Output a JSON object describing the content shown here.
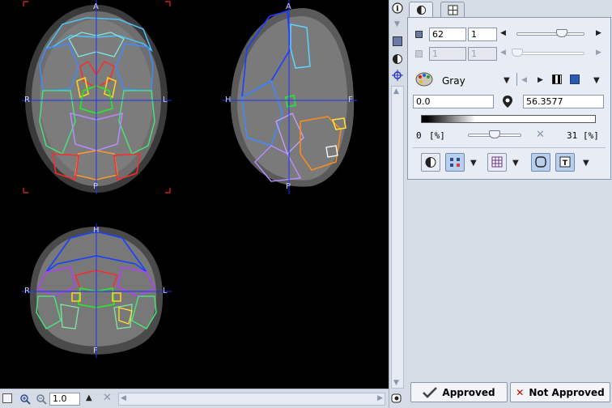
{
  "viewer": {
    "axial": {
      "top": "A",
      "bottom": "P",
      "left": "R",
      "right": "L"
    },
    "sagittal": {
      "top": "A",
      "bottom": "P",
      "left": "H",
      "right": "F"
    },
    "coronal": {
      "top": "H",
      "bottom": "F",
      "left": "R",
      "right": "L"
    }
  },
  "bottom_bar": {
    "zoom": "1.0"
  },
  "panel": {
    "tabs": [
      {
        "icon": "contrast-icon",
        "active": true
      },
      {
        "icon": "layout-icon",
        "active": false
      }
    ],
    "slice": {
      "value": "62",
      "step": "1",
      "slider_fraction": 0.67
    },
    "frame": {
      "value": "1",
      "step": "1",
      "disabled": true
    },
    "colormap": {
      "name": "Gray"
    },
    "range": {
      "min": "0.0",
      "max": "56.3577"
    },
    "percent": {
      "low": "0",
      "low_unit": "[%]",
      "high": "31",
      "high_unit": "[%]",
      "slider_fraction": 0.5
    }
  },
  "buttons": {
    "approved": "Approved",
    "not_approved": "Not Approved"
  },
  "colors": {
    "crosshair": "#2030ff",
    "corner_marks": "#cc2222",
    "panel_bg": "#d6dce6",
    "reject_x": "#cc0000"
  }
}
